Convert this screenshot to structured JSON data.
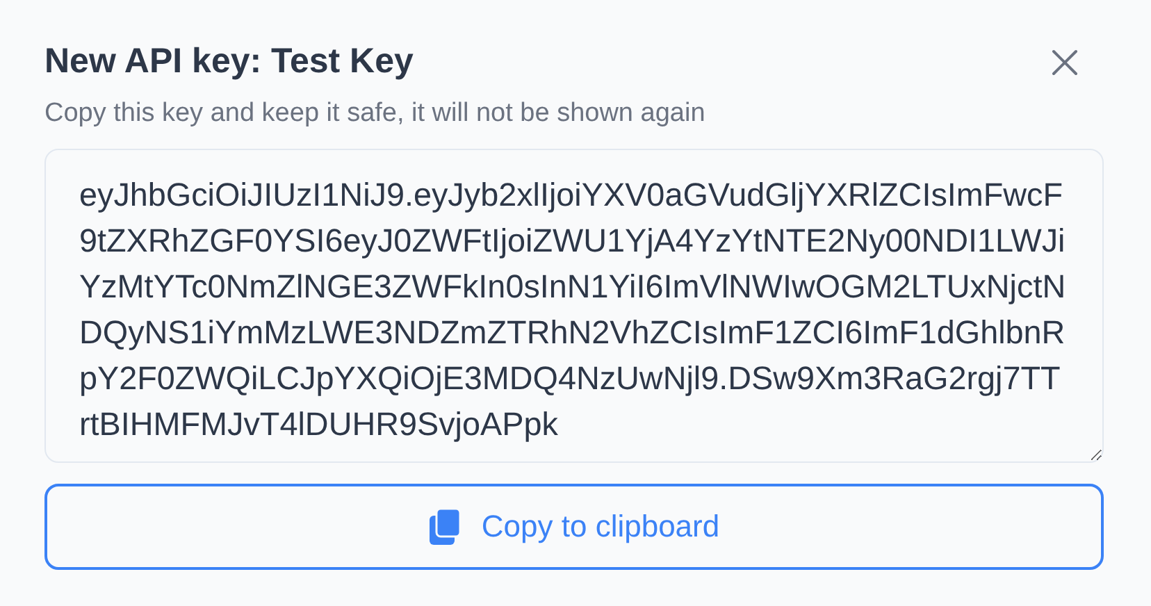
{
  "dialog": {
    "title": "New API key: Test Key",
    "description": "Copy this key and keep it safe, it will not be shown again",
    "key": "eyJhbGciOiJIUzI1NiJ9.eyJyb2xlIjoiYXV0aGVudGljYXRlZCIsImFwcF9tZXRhZGF0YSI6eyJ0ZWFtIjoiZWU1YjA4YzYtNTE2Ny00NDI1LWJiYzMtYTc0NmZlNGE3ZWFkIn0sInN1YiI6ImVlNWIwOGM2LTUxNjctNDQyNS1iYmMzLWE3NDZmZTRhN2VhZCIsImF1ZCI6ImF1dGhlbnRpY2F0ZWQiLCJpYXQiOjE3MDQ4NzUwNjl9.DSw9Xm3RaG2rgj7TTrtBIHMFMJvT4lDUHR9SvjoAPpk",
    "copy_button": "Copy to clipboard"
  }
}
